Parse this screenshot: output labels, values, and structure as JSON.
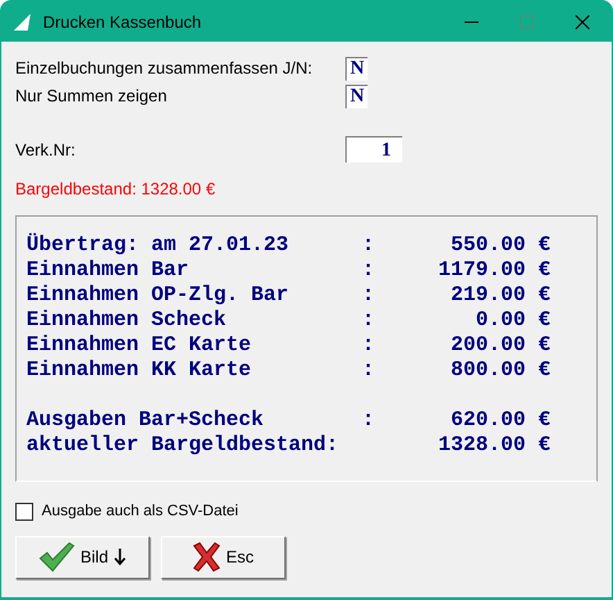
{
  "window": {
    "title": "Drucken Kassenbuch"
  },
  "options": [
    {
      "label": "Einzelbuchungen zusammenfassen J/N:",
      "value": "N"
    },
    {
      "label": "Nur Summen zeigen",
      "value": "N"
    }
  ],
  "verk_nr": {
    "label": "Verk.Nr:",
    "value": "1"
  },
  "cash_balance": "Bargeldbestand: 1328.00 €",
  "report": [
    {
      "label": "Übertrag: am 27.01.23",
      "sep": ":",
      "amount": "550.00 €"
    },
    {
      "label": "Einnahmen Bar",
      "sep": ":",
      "amount": "1179.00 €"
    },
    {
      "label": "Einnahmen OP-Zlg. Bar",
      "sep": ":",
      "amount": "219.00 €"
    },
    {
      "label": "Einnahmen Scheck",
      "sep": ":",
      "amount": "0.00 €"
    },
    {
      "label": "Einnahmen EC Karte",
      "sep": ":",
      "amount": "200.00 €"
    },
    {
      "label": "Einnahmen KK Karte",
      "sep": ":",
      "amount": "800.00 €"
    },
    {
      "kind": "blank"
    },
    {
      "label": "Ausgaben Bar+Scheck",
      "sep": ":",
      "amount": "620.00 €"
    },
    {
      "label": "aktueller Bargeldbestand:",
      "amount": "1328.00 €"
    }
  ],
  "csv_option": {
    "label": "Ausgabe auch als CSV-Datei",
    "checked": false
  },
  "buttons": [
    {
      "kind": "ok",
      "label": "Bild"
    },
    {
      "kind": "cancel",
      "label": "Esc"
    }
  ]
}
